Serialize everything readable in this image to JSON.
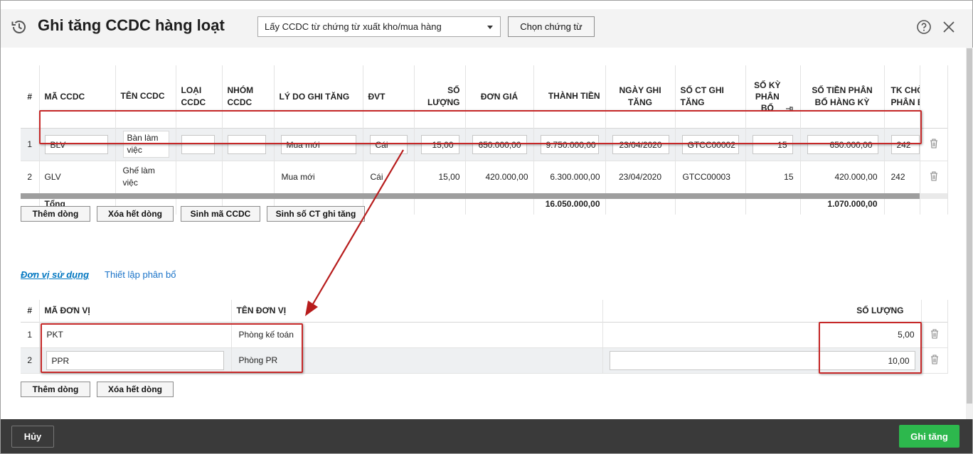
{
  "header": {
    "title": "Ghi tăng CCDC hàng loạt",
    "source_select": "Lấy CCDC từ chứng từ xuất kho/mua hàng",
    "choose_voucher_button": "Chọn chứng từ"
  },
  "tools_table": {
    "columns": {
      "num": "#",
      "code": "MÃ CCDC",
      "name": "TÊN CCDC",
      "type": "LOẠI CCDC",
      "group": "NHÓM CCDC",
      "reason": "LÝ DO GHI TĂNG",
      "unit": "ĐVT",
      "qty": "SỐ LƯỢNG",
      "price": "ĐƠN GIÁ",
      "amount": "THÀNH TIỀN",
      "date": "NGÀY GHI TĂNG",
      "voucher": "SỐ CT GHI TĂNG",
      "periods": "SỐ KỲ PHÂN BỔ",
      "alloc": "SỐ TIỀN PHÂN BỔ HÀNG KỲ",
      "account": "TK CHỜ PHÂN B"
    },
    "rows": [
      {
        "num": "1",
        "code": "BLV",
        "name": "Bàn làm việc",
        "type": "",
        "group": "",
        "reason": "Mua mới",
        "unit": "Cái",
        "qty": "15,00",
        "price": "650.000,00",
        "amount": "9.750.000,00",
        "date": "23/04/2020",
        "voucher": "GTCC00002",
        "periods": "15",
        "alloc": "650.000,00",
        "account": "242"
      },
      {
        "num": "2",
        "code": "GLV",
        "name": "Ghế làm việc",
        "type": "",
        "group": "",
        "reason": "Mua mới",
        "unit": "Cái",
        "qty": "15,00",
        "price": "420.000,00",
        "amount": "6.300.000,00",
        "date": "23/04/2020",
        "voucher": "GTCC00003",
        "periods": "15",
        "alloc": "420.000,00",
        "account": "242"
      }
    ],
    "total": {
      "label": "Tổng",
      "amount": "16.050.000,00",
      "alloc": "1.070.000,00"
    }
  },
  "tools_actions": {
    "add_row": "Thêm dòng",
    "delete_all": "Xóa hết dòng",
    "gen_code": "Sinh mã CCDC",
    "gen_voucher": "Sinh số CT ghi tăng"
  },
  "tabs": {
    "units": "Đơn vị sử dụng",
    "allocation": "Thiết lập phân bổ"
  },
  "units_table": {
    "columns": {
      "num": "#",
      "code": "MÃ ĐƠN VỊ",
      "name": "TÊN ĐƠN VỊ",
      "qty": "SỐ LƯỢNG"
    },
    "rows": [
      {
        "num": "1",
        "code": "PKT",
        "name": "Phòng kế toán",
        "qty": "5,00"
      },
      {
        "num": "2",
        "code": "PPR",
        "name": "Phòng PR",
        "qty": "10,00"
      }
    ]
  },
  "units_actions": {
    "add_row": "Thêm dòng",
    "delete_all": "Xóa hết dòng"
  },
  "footer": {
    "cancel": "Hủy",
    "submit": "Ghi tăng"
  },
  "colors": {
    "accent_green": "#2db84d",
    "link_blue": "#0076c0",
    "annotation_red": "#c62828",
    "footer_bg": "#3a3a3a"
  }
}
